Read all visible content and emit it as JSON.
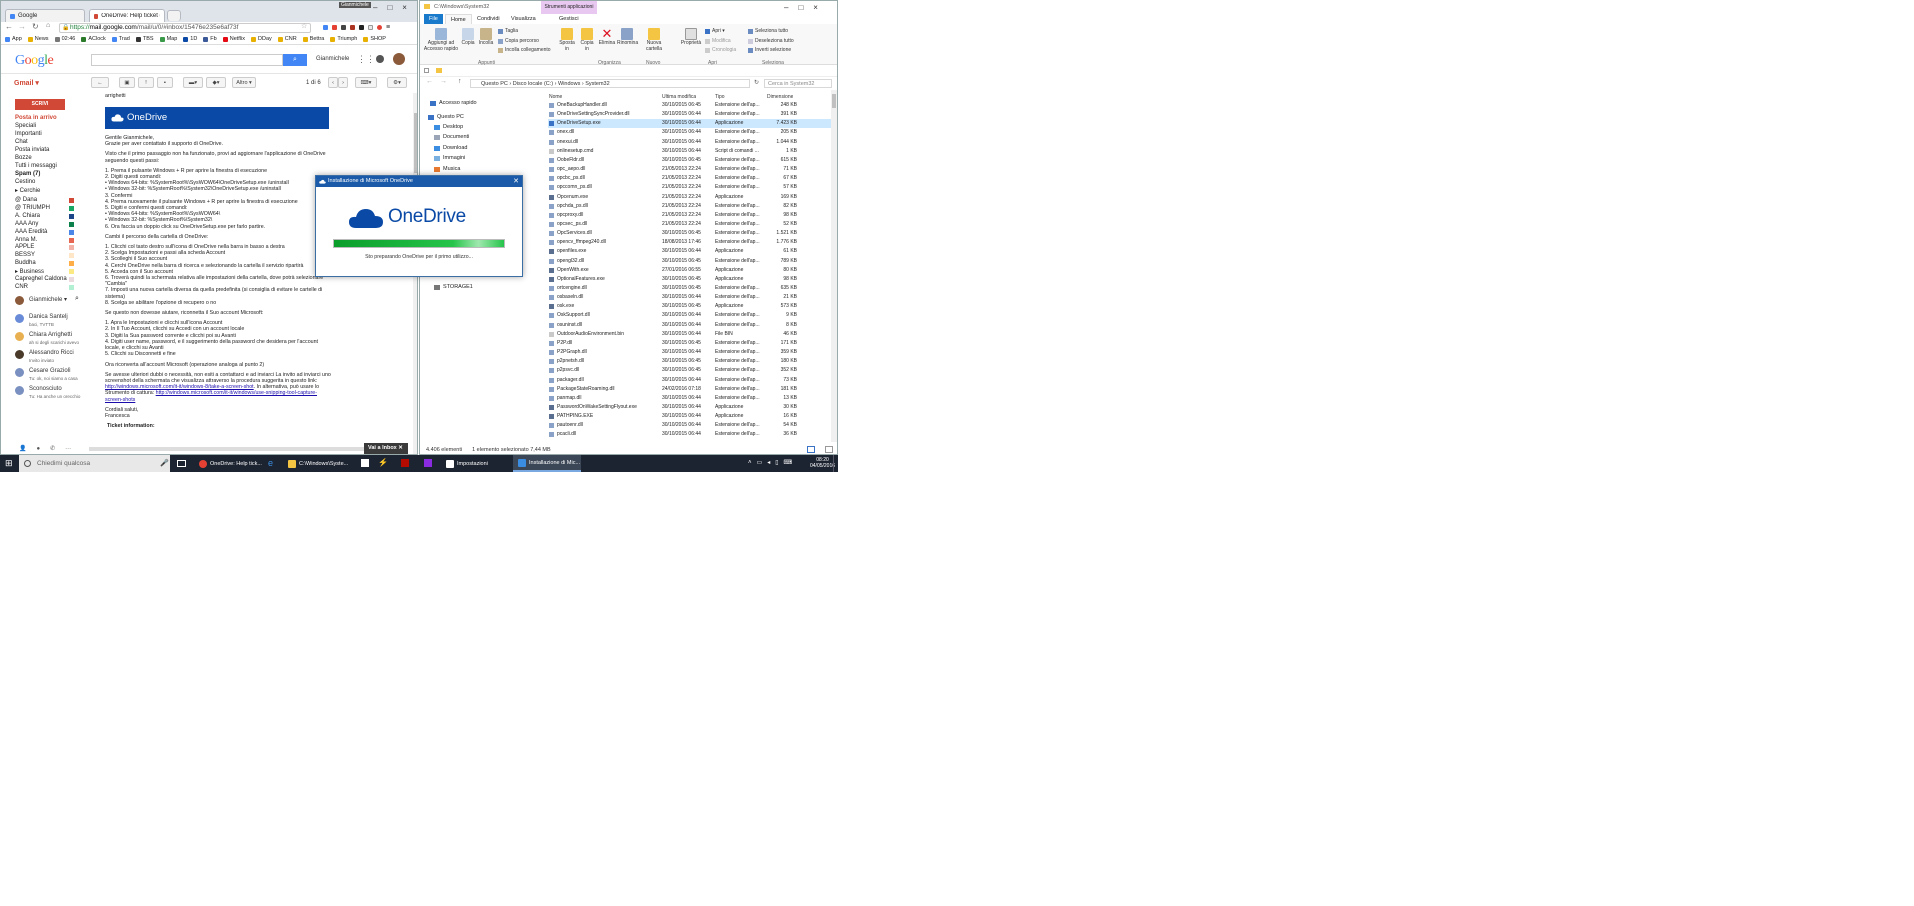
{
  "chrome": {
    "tabs": [
      {
        "label": "Google"
      },
      {
        "label": "OneDrive: Help ticket #3..."
      }
    ],
    "profile": "Gianmichele",
    "url_scheme": "https://",
    "url_host": "mail.google.com",
    "url_rest": "/mail/u/0/#inbox/15476e235e6af73f",
    "bookmarks": [
      "App",
      "News",
      "02:46",
      "AClock",
      "Trad",
      "TBS",
      "Map",
      "1D",
      "Fb",
      "Netflix",
      "DDay",
      "CNR",
      "Bettra",
      "Triumph",
      "SHOP"
    ]
  },
  "gmail": {
    "logo": "Google",
    "user": "Gianmichele",
    "gmail_label": "Gmail ▾",
    "altro": "Altro ▾",
    "pager": "1 di 6",
    "compose": "SCRIVI",
    "labels": [
      "Posta in arrivo",
      "Speciali",
      "Importanti",
      "Chat",
      "Posta inviata",
      "Bozze",
      "Tutti i messaggi",
      "Spam (7)",
      "Cestino",
      "▸ Cerchie",
      "@ Dana",
      "@ TRIUMPH",
      "A. Chiara",
      "AAA Any",
      "AAA Eredità",
      "Anna M.",
      "APPLE",
      "BESSY",
      "Buddha",
      "▸ Business",
      "Capreghel Caldona",
      "CNR"
    ],
    "label_colors": [
      "#d14836",
      "#16a765",
      "#1c4587",
      "#0b804b",
      "#4986e7",
      "#e66550",
      "#f2b2a8",
      "#ffe6c7",
      "#ffad46",
      "#fbe983",
      "#ebdbde",
      "#b3efd3",
      "#a0eac9",
      "#b99aff"
    ],
    "hangouts_user": "Gianmichele ▾",
    "contacts": [
      {
        "name": "Danica Santelj",
        "status": "baci, TVTTB"
      },
      {
        "name": "Chiara Arrighetti",
        "status": "ah si degli scarichi avevo"
      },
      {
        "name": "Alessandro Ricci",
        "status": "Invito inviato"
      },
      {
        "name": "Cesare Graziolì",
        "status": "Tu: ok, noi siamo a casa"
      },
      {
        "name": "Sconosciuto",
        "status": "Tu: Ha anche un orecchio"
      }
    ],
    "message": {
      "attachments": "arrighetti",
      "banner": "OneDrive",
      "greeting": "Gentile Gianmichele,",
      "thanks": "Grazie per aver contattato il supporto di OneDrive.",
      "p1": "Visto che il primo passaggio non ha funzionato, provi ad aggiornare l'applicazione di OneDrive seguendo questi passi:",
      "steps1": [
        "1. Prema il pulsante Windows + R per aprire la finestra di esecuzione",
        "2. Digiti questi comandi:",
        "• Windows 64-bits: %SystemRoot%\\SysWOW64\\OneDriveSetup.exe /uninstall",
        "• Windows 32-bit: %SystemRoot%\\System32\\OneDriveSetup.exe /uninstall",
        "3. Confermi",
        "4. Prema nuovamente il pulsante Windows + R per aprire la finestra di esecuzione",
        "5. Digiti e confermi questi comandi:",
        "• Windows 64-bits: %SystemRoot%\\SysWOW64\\",
        "• Windows 32-bit: %SystemRoot%\\System32\\",
        "6. Ora faccia un doppio click su OneDriveSetup.exe per farlo partire."
      ],
      "p2": "Cambi il percorso della cartella di OneDrive:",
      "steps2": [
        "1. Clicchi col tasto destro sull'icona di OneDrive nella barra in basso a destra",
        "2. Scelga Impostazioni e passi alla scheda Account",
        "3. Scolleghi il Suo account",
        "4. Cerchi OneDrive nella barra di ricerca e selezionando la cartella il servizio ripartirà",
        "5. Acceda con il Suo account",
        "6. Troverà quindi la schermata relativa alle impostazioni della cartella, dove potrà selezionare \"Cambia\"",
        "7. Imposti una nuova cartella diversa da quella predefinita (si consiglia di evitare le cartelle di sistema)",
        "8. Scelga se abilitare l'opzione di recupero o no"
      ],
      "p3": "Se questo non dovesse aiutare, riconnetta il Suo account Microsoft:",
      "steps3": [
        "1. Apra le Impostazioni e clicchi sull'icona Account",
        "2. In Il Tuo Account, clicchi su Accedi con un account locale",
        "3. Digiti la Sua password corrente e clicchi poi su Avanti",
        "4. Digiti user name, password, e il suggerimento della password che desidera per l'account locale, e clicchi su Avanti",
        "5. Clicchi su Disconnetti e fine"
      ],
      "p4": "Ora riconverta all'account Microsoft (operazione analoga al punto 2)",
      "p5": "Se avesse ulteriori dubbi o necessità, non esiti a contattarci e ad inviarci La invito ad inviarci uno screenshot della schermata che visualizza attraverso la procedura suggerita in questo link:",
      "link1": "http://windows.microsoft.com/it-it/windows-8/take-a-screen-shot",
      "p5b": ". In alternativa, può usare lo Strumento di cattura:",
      "link2": "http://windows.microsoft.com/it-it/windows/use-snipping-tool-capture-screen-shots",
      "sign1": "Cordiali saluti,",
      "sign2": "Francesca",
      "ticket": "Ticket information:"
    },
    "vai_inbox": "Vai a Inbox"
  },
  "explorer": {
    "title": "C:\\Windows\\System32",
    "context_tab": "Strumenti applicazioni",
    "tabs": [
      "File",
      "Home",
      "Condividi",
      "Visualizza",
      "Gestisci"
    ],
    "ribbon": {
      "pin": "Aggiungi ad Accesso rapido",
      "copy": "Copia",
      "paste": "Incolla",
      "cut": "Taglia",
      "copy_path": "Copia percorso",
      "paste_link": "Incolla collegamento",
      "move": "Sposta in",
      "copyto": "Copia in",
      "delete": "Elimina",
      "rename": "Rinomina",
      "newfolder": "Nuova cartella",
      "props": "Proprietà",
      "open": "Apri ▾",
      "edit": "Modifica",
      "history": "Cronologia",
      "selall": "Seleziona tutto",
      "selnone": "Deseleziona tutto",
      "invert": "Inverti selezione",
      "groups": [
        "Appunti",
        "Organizza",
        "Nuovo",
        "Apri",
        "Seleziona"
      ]
    },
    "breadcrumb": "Questo PC  ›  Disco locale (C:)  ›  Windows  ›  System32",
    "search": "Cerca in System32",
    "nav": [
      "Accesso rapido",
      "Questo PC",
      "Desktop",
      "Documenti",
      "Download",
      "Immagini",
      "Musica",
      "STORAGE1"
    ],
    "headers": [
      "Nome",
      "Ultima modifica",
      "Tipo",
      "Dimensione"
    ],
    "files": [
      [
        "OneBackupHandler.dll",
        "30/10/2015 06:45",
        "Estensione dell'ap...",
        "248 KB"
      ],
      [
        "OneDriveSettingSyncProvider.dll",
        "30/10/2015 06:44",
        "Estensione dell'ap...",
        "391 KB"
      ],
      [
        "OneDriveSetup.exe",
        "30/10/2015 06:44",
        "Applicazione",
        "7.423 KB"
      ],
      [
        "onex.dll",
        "30/10/2015 06:44",
        "Estensione dell'ap...",
        "205 KB"
      ],
      [
        "onexui.dll",
        "30/10/2015 06:44",
        "Estensione dell'ap...",
        "1.044 KB"
      ],
      [
        "onlinesetup.cmd",
        "30/10/2015 06:44",
        "Script di comandi ...",
        "1 KB"
      ],
      [
        "OobeFldr.dll",
        "30/10/2015 06:45",
        "Estensione dell'ap...",
        "615 KB"
      ],
      [
        "opc_aepo.dll",
        "21/05/2013 22:24",
        "Estensione dell'ap...",
        "71 KB"
      ],
      [
        "opcbc_ps.dll",
        "21/05/2013 22:24",
        "Estensione dell'ap...",
        "67 KB"
      ],
      [
        "opccomn_ps.dll",
        "21/05/2013 22:24",
        "Estensione dell'ap...",
        "57 KB"
      ],
      [
        "Opcenum.exe",
        "21/05/2013 22:24",
        "Applicazione",
        "169 KB"
      ],
      [
        "opchda_ps.dll",
        "21/05/2013 22:24",
        "Estensione dell'ap...",
        "82 KB"
      ],
      [
        "opcproxy.dll",
        "21/05/2013 22:24",
        "Estensione dell'ap...",
        "98 KB"
      ],
      [
        "opcsec_ps.dll",
        "21/05/2013 22:24",
        "Estensione dell'ap...",
        "52 KB"
      ],
      [
        "OpcServices.dll",
        "30/10/2015 06:45",
        "Estensione dell'ap...",
        "1.521 KB"
      ],
      [
        "opencv_ffmpeg240.dll",
        "18/08/2013 17:46",
        "Estensione dell'ap...",
        "1.776 KB"
      ],
      [
        "openfiles.exe",
        "30/10/2015 06:44",
        "Applicazione",
        "61 KB"
      ],
      [
        "opengl32.dll",
        "30/10/2015 06:45",
        "Estensione dell'ap...",
        "789 KB"
      ],
      [
        "OpenWith.exe",
        "27/01/2016 06:55",
        "Applicazione",
        "80 KB"
      ],
      [
        "OptionalFeatures.exe",
        "30/10/2015 06:45",
        "Applicazione",
        "98 KB"
      ],
      [
        "ortcengine.dll",
        "30/10/2015 06:45",
        "Estensione dell'ap...",
        "635 KB"
      ],
      [
        "osbaseln.dll",
        "30/10/2015 06:44",
        "Estensione dell'ap...",
        "21 KB"
      ],
      [
        "osk.exe",
        "30/10/2015 06:45",
        "Applicazione",
        "573 KB"
      ],
      [
        "OskSupport.dll",
        "30/10/2015 06:44",
        "Estensione dell'ap...",
        "9 KB"
      ],
      [
        "osuninst.dll",
        "30/10/2015 06:44",
        "Estensione dell'ap...",
        "8 KB"
      ],
      [
        "OutdoorAudioEnvironment.bin",
        "30/10/2015 06:44",
        "File BIN",
        "46 KB"
      ],
      [
        "P2P.dll",
        "30/10/2015 06:45",
        "Estensione dell'ap...",
        "171 KB"
      ],
      [
        "P2PGraph.dll",
        "30/10/2015 06:44",
        "Estensione dell'ap...",
        "359 KB"
      ],
      [
        "p2pnetsh.dll",
        "30/10/2015 06:45",
        "Estensione dell'ap...",
        "180 KB"
      ],
      [
        "p2psvc.dll",
        "30/10/2015 06:45",
        "Estensione dell'ap...",
        "352 KB"
      ],
      [
        "packager.dll",
        "30/10/2015 06:44",
        "Estensione dell'ap...",
        "73 KB"
      ],
      [
        "PackageStateRoaming.dll",
        "24/02/2016 07:18",
        "Estensione dell'ap...",
        "181 KB"
      ],
      [
        "panmap.dll",
        "30/10/2015 06:44",
        "Estensione dell'ap...",
        "13 KB"
      ],
      [
        "PasswordOnWakeSettingFlyout.exe",
        "30/10/2015 06:44",
        "Applicazione",
        "30 KB"
      ],
      [
        "PATHPING.EXE",
        "30/10/2015 06:44",
        "Applicazione",
        "16 KB"
      ],
      [
        "pautoenr.dll",
        "30/10/2015 06:44",
        "Estensione dell'ap...",
        "54 KB"
      ],
      [
        "pcacli.dll",
        "30/10/2015 06:44",
        "Estensione dell'ap...",
        "36 KB"
      ]
    ],
    "file_icon_colors": [
      "#8aa2c8",
      "#8aa2c8",
      "#3a72c6",
      "#8aa2c8",
      "#8aa2c8",
      "#c9c9c9",
      "#8aa2c8",
      "#8aa2c8",
      "#8aa2c8",
      "#8aa2c8",
      "#5a6e90",
      "#8aa2c8",
      "#8aa2c8",
      "#8aa2c8",
      "#8aa2c8",
      "#8aa2c8",
      "#5a6e90",
      "#8aa2c8",
      "#5a6e90",
      "#5a6e90",
      "#8aa2c8",
      "#8aa2c8",
      "#5a6e90",
      "#8aa2c8",
      "#8aa2c8",
      "#c9c9c9",
      "#8aa2c8",
      "#8aa2c8",
      "#8aa2c8",
      "#8aa2c8",
      "#8aa2c8",
      "#8aa2c8",
      "#8aa2c8",
      "#5a6e90",
      "#5a6e90",
      "#8aa2c8",
      "#8aa2c8"
    ],
    "selected_index": 2,
    "status_count": "4.406 elementi",
    "status_sel": "1 elemento selezionato  7,44 MB"
  },
  "dialog": {
    "title": "Installazione di Microsoft OneDrive",
    "logo": "OneDrive",
    "progress": 1.0,
    "message": "Sto preparando OneDrive per il primo utilizzo..."
  },
  "taskbar": {
    "search": "Chiedimi qualcosa",
    "items": [
      {
        "label": "OneDrive: Help tick...",
        "color": "#e44134"
      },
      {
        "label": "C:\\Windows\\Syste...",
        "color": "#f4c542"
      },
      {
        "label": "Impostazioni",
        "color": "#ffffff"
      },
      {
        "label": "Installazione di Mic...",
        "color": "#3a8de0"
      }
    ],
    "time": "08:20",
    "date": "04/05/2016"
  },
  "colors": {
    "accent": "#0a4aa6",
    "gmail_red": "#d14836",
    "progress": "#26c44a",
    "taskbar": "#1d2431"
  }
}
